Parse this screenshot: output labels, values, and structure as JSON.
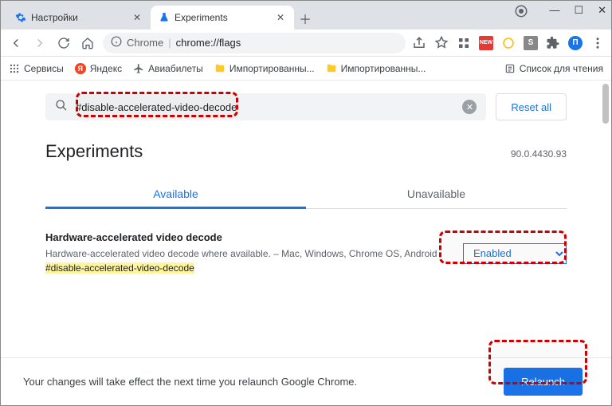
{
  "window": {
    "tabs": [
      {
        "title": "Настройки",
        "active": false,
        "icon_color": "#1a73e8"
      },
      {
        "title": "Experiments",
        "active": true,
        "icon_color": "#1a73e8"
      }
    ]
  },
  "toolbar": {
    "url_prefix": "Chrome",
    "url_path": "chrome://flags"
  },
  "bookmarks": {
    "items": [
      {
        "label": "Сервисы"
      },
      {
        "label": "Яндекс"
      },
      {
        "label": "Авиабилеты"
      },
      {
        "label": "Импортированны..."
      },
      {
        "label": "Импортированны..."
      }
    ],
    "reading_list": "Список для чтения"
  },
  "flags": {
    "search_value": "#disable-accelerated-video-decode",
    "reset_label": "Reset all",
    "page_title": "Experiments",
    "version": "90.0.4430.93",
    "tab_available": "Available",
    "tab_unavailable": "Unavailable",
    "item": {
      "name": "Hardware-accelerated video decode",
      "desc": "Hardware-accelerated video decode where available. – Mac, Windows, Chrome OS, Android",
      "hash": "#disable-accelerated-video-decode",
      "selected": "Enabled"
    }
  },
  "footer": {
    "message": "Your changes will take effect the next time you relaunch Google Chrome.",
    "button": "Relaunch"
  }
}
